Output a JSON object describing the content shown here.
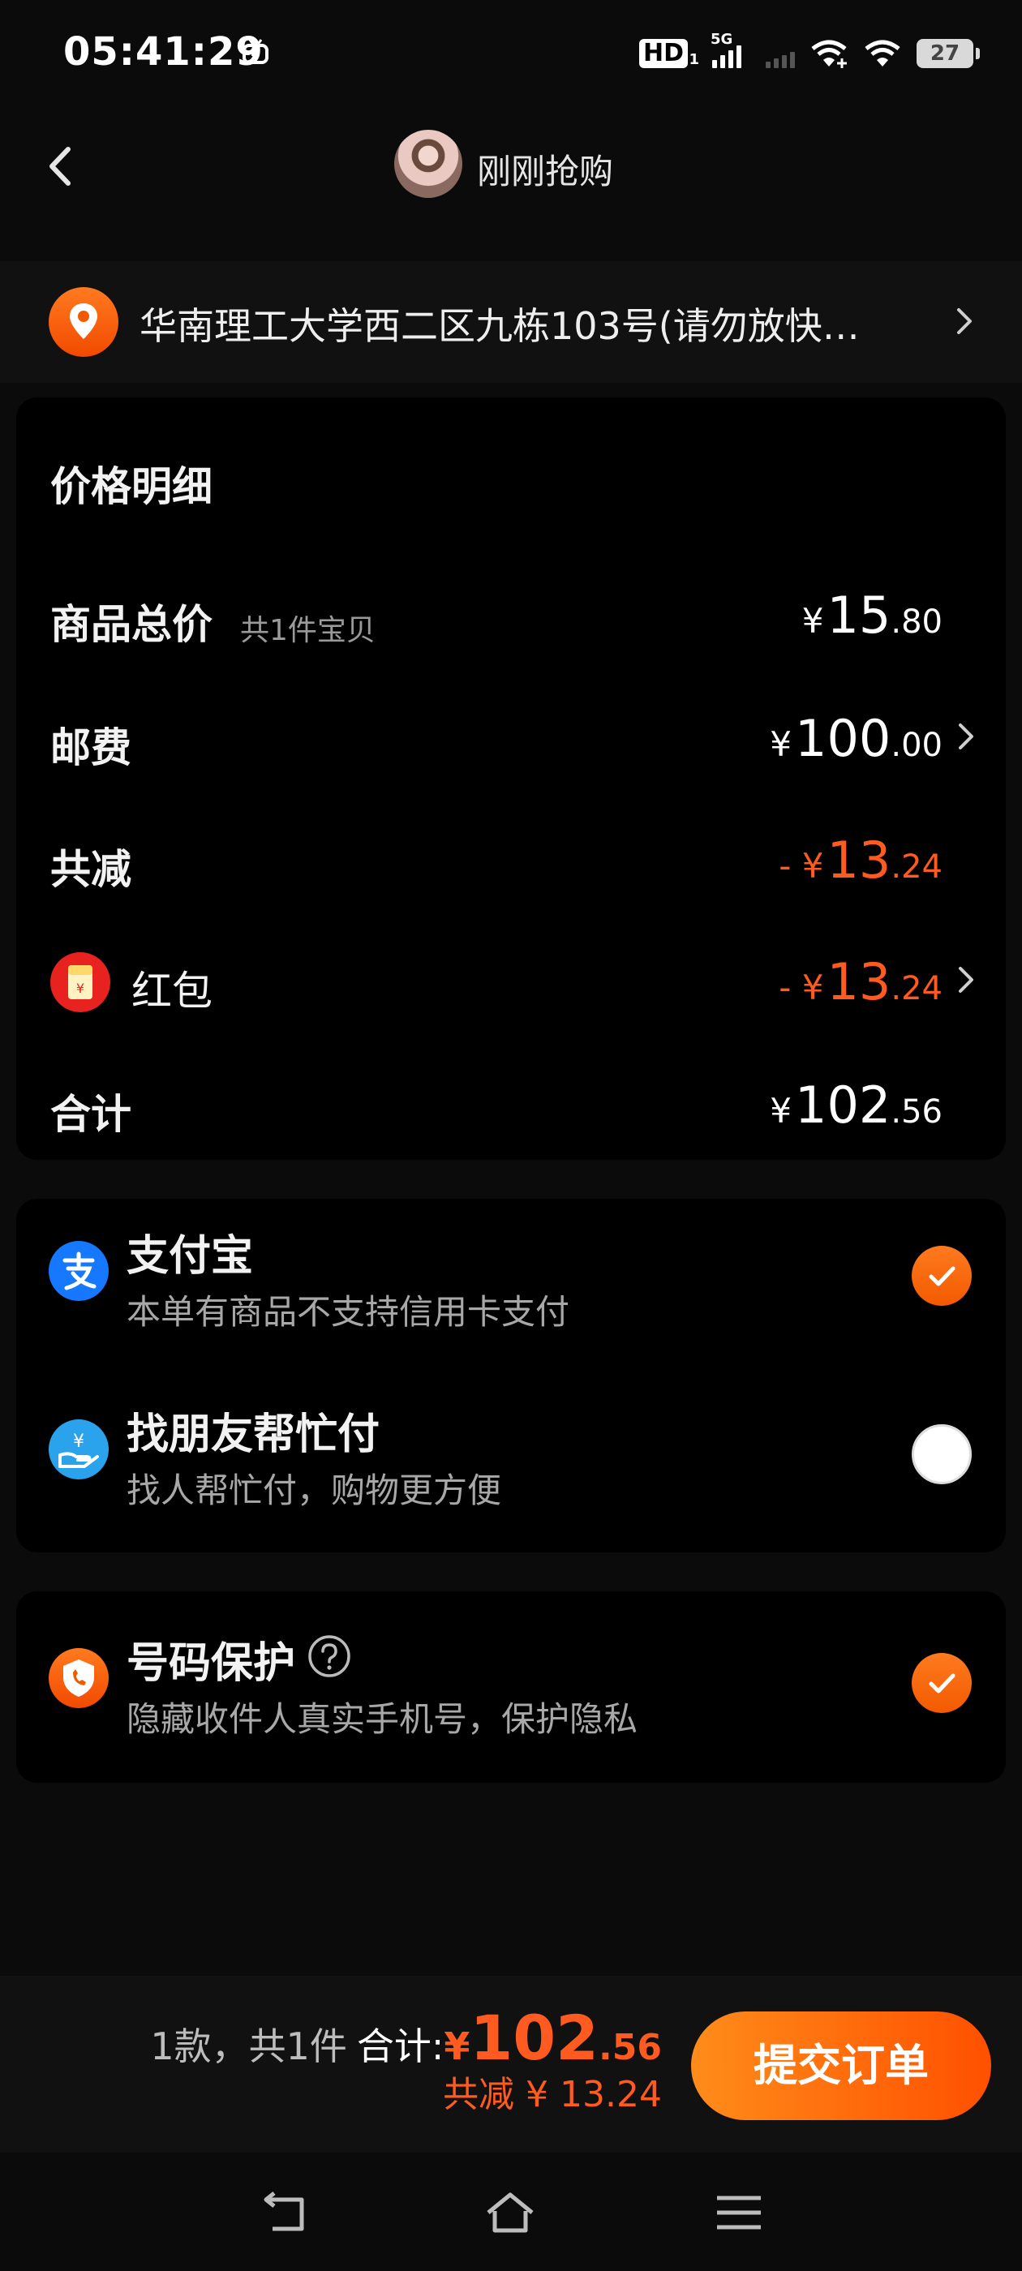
{
  "status_bar": {
    "time": "05:41:29",
    "hd": "HD",
    "hd_sub": "1",
    "network": "5G",
    "battery": "27"
  },
  "header": {
    "seller_name": "刚刚抢购"
  },
  "address": {
    "text": "华南理工大学西二区九栋103号(请勿放快…"
  },
  "price_detail": {
    "title": "价格明细",
    "goods_total": {
      "label": "商品总价",
      "sub": "共1件宝贝",
      "yen": "¥",
      "int": "15",
      "dec": ".80"
    },
    "shipping": {
      "label": "邮费",
      "yen": "¥",
      "int": "100",
      "dec": ".00"
    },
    "discount": {
      "label": "共减",
      "prefix": "- ¥",
      "int": "13",
      "dec": ".24"
    },
    "red_packet": {
      "label": "红包",
      "prefix": "- ¥",
      "int": "13",
      "dec": ".24"
    },
    "total": {
      "label": "合计",
      "yen": "¥",
      "int": "102",
      "dec": ".56"
    }
  },
  "payment": {
    "alipay": {
      "title": "支付宝",
      "desc": "本单有商品不支持信用卡支付",
      "selected": true
    },
    "friend_pay": {
      "title": "找朋友帮忙付",
      "desc": "找人帮忙付，购物更方便",
      "selected": false
    }
  },
  "privacy": {
    "title": "号码保护",
    "desc": "隐藏收件人真实手机号，保护隐私",
    "selected": true
  },
  "bottom_bar": {
    "count": "1款，共1件",
    "total_label": "合计:",
    "yen": "¥",
    "int": "102",
    "dec": ".56",
    "discount": "共减 ¥ 13.24",
    "submit_label": "提交订单"
  },
  "colors": {
    "accent": "#ff5a1f",
    "background": "#0b0b0b",
    "card": "#000000",
    "alipay_blue": "#1677ff",
    "red_packet": "#e8221f"
  }
}
